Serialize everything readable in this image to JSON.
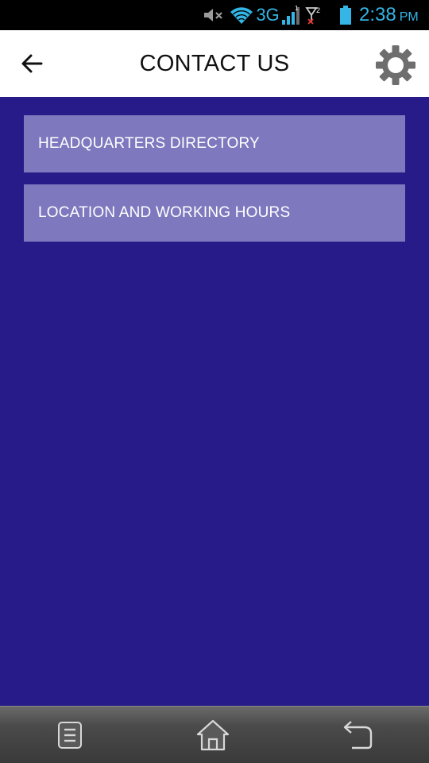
{
  "status_bar": {
    "network_type": "3G",
    "time": "2:38",
    "ampm": "PM",
    "icons": [
      "mute-icon",
      "wifi-icon",
      "signal-icon",
      "sim-icon",
      "battery-icon"
    ],
    "accent_color": "#33b5e5"
  },
  "app_bar": {
    "title": "CONTACT US",
    "back_icon": "arrow-left-icon",
    "settings_icon": "gear-icon"
  },
  "menu": {
    "items": [
      {
        "label": "HEADQUARTERS DIRECTORY"
      },
      {
        "label": "LOCATION AND WORKING HOURS"
      }
    ]
  },
  "nav_bar": {
    "icons": [
      "menu-icon",
      "home-icon",
      "back-icon"
    ]
  },
  "colors": {
    "background": "#261b88",
    "menu_item": "#7e79be",
    "app_bar": "#ffffff"
  }
}
